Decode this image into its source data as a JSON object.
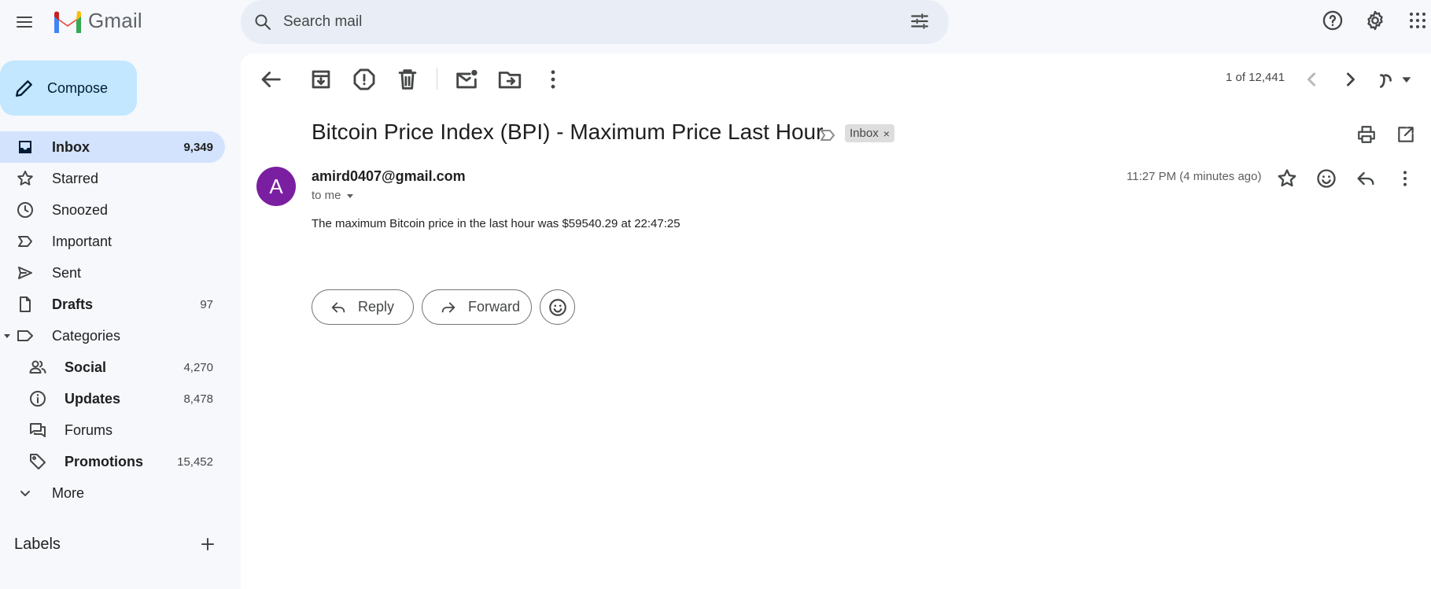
{
  "app": {
    "name": "Gmail"
  },
  "search": {
    "placeholder": "Search mail"
  },
  "sidebar": {
    "compose_label": "Compose",
    "items": [
      {
        "label": "Inbox",
        "count": "9,349",
        "icon": "inbox-icon"
      },
      {
        "label": "Starred",
        "count": "",
        "icon": "star-icon"
      },
      {
        "label": "Snoozed",
        "count": "",
        "icon": "clock-icon"
      },
      {
        "label": "Important",
        "count": "",
        "icon": "important-icon"
      },
      {
        "label": "Sent",
        "count": "",
        "icon": "send-icon"
      },
      {
        "label": "Drafts",
        "count": "97",
        "icon": "draft-icon"
      },
      {
        "label": "Categories",
        "count": "",
        "icon": "label-icon"
      }
    ],
    "categories": [
      {
        "label": "Social",
        "count": "4,270",
        "icon": "people-icon"
      },
      {
        "label": "Updates",
        "count": "8,478",
        "icon": "info-icon"
      },
      {
        "label": "Forums",
        "count": "",
        "icon": "forum-icon"
      },
      {
        "label": "Promotions",
        "count": "15,452",
        "icon": "tag-icon"
      }
    ],
    "more_label": "More",
    "labels_heading": "Labels"
  },
  "toolbar": {
    "pager": "1 of 12,441"
  },
  "message": {
    "subject": "Bitcoin Price Index (BPI) - Maximum Price Last Hour",
    "chip_label": "Inbox",
    "chip_remove": "×",
    "avatar_letter": "A",
    "sender": "amird0407@gmail.com",
    "to": "to me",
    "timestamp": "11:27 PM (4 minutes ago)",
    "body": "The maximum Bitcoin price in the last hour was $59540.29 at 22:47:25"
  },
  "actions": {
    "reply_label": "Reply",
    "forward_label": "Forward"
  },
  "colors": {
    "background": "#f6f8fc",
    "compose": "#c2e7ff",
    "active_nav": "#d3e3fd",
    "search": "#e9eef6",
    "avatar": "#7b1fa2"
  }
}
